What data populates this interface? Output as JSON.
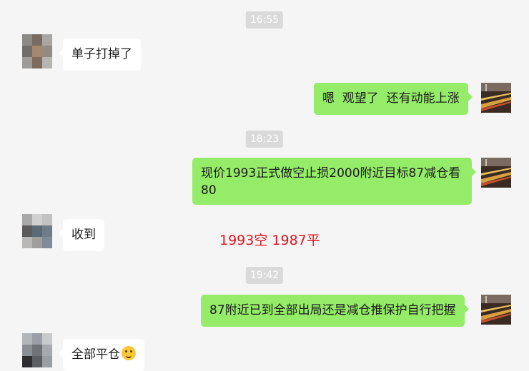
{
  "timestamps": [
    "16:55",
    "18:23",
    "19:42"
  ],
  "messages": [
    {
      "side": "left",
      "text": "单子打掉了"
    },
    {
      "side": "right",
      "text": "嗯  观望了  还有动能上涨"
    },
    {
      "side": "right",
      "text": "现价1993正式做空止损2000附近目标87减仓看80"
    },
    {
      "side": "left",
      "text": "收到"
    },
    {
      "side": "right",
      "text": "87附近已到全部出局还是减仓推保护自行把握"
    },
    {
      "side": "left",
      "text": "全部平仓",
      "emoji": "thinking-face-emoji"
    }
  ],
  "annotation": "1993空 1987平",
  "colors": {
    "background": "#f5f5f5",
    "right_bubble": "#95ec69",
    "left_bubble": "#ffffff",
    "timestamp_bg": "#dadada",
    "annotation": "#e0141e"
  }
}
